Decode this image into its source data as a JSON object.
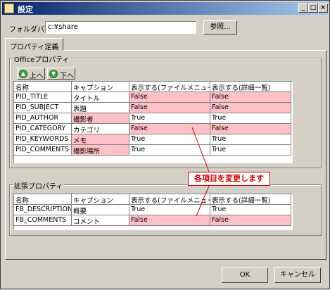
{
  "window": {
    "title": "設定"
  },
  "titlebar_buttons": [
    "_",
    "□",
    "×"
  ],
  "folder": {
    "label": "フォルダパス",
    "value": "c:¥share",
    "browse_label": "参照..."
  },
  "tab": {
    "label": "プロパティ定義"
  },
  "office": {
    "group_title": "Officeプロパティ",
    "up_label": "上へ",
    "down_label": "下へ",
    "columns": [
      "名称",
      "キャプション",
      "表示する(ファイルメニュー)",
      "表示する(詳細一覧)"
    ],
    "rows": [
      {
        "name": "PID_TITLE",
        "caption": "タイトル",
        "file_menu": "False",
        "detail": "False"
      },
      {
        "name": "PID_SUBJECT",
        "caption": "表題",
        "file_menu": "False",
        "detail": "False"
      },
      {
        "name": "PID_AUTHOR",
        "caption": "撮影者",
        "file_menu": "True",
        "detail": "True"
      },
      {
        "name": "PID_CATEGORY",
        "caption": "カテゴリ",
        "file_menu": "False",
        "detail": "False"
      },
      {
        "name": "PID_KEYWORDS",
        "caption": "メモ",
        "file_menu": "True",
        "detail": "True"
      },
      {
        "name": "PID_COMMENTS",
        "caption": "撮影場所",
        "file_menu": "True",
        "detail": "True"
      }
    ]
  },
  "extended": {
    "group_title": "拡張プロパティ",
    "columns": [
      "名称",
      "キャプション",
      "表示する(ファイルメニュー)",
      "表示する(詳細一覧)"
    ],
    "rows": [
      {
        "name": "FB_DESCRIPTION",
        "caption": "概要",
        "file_menu": "True",
        "detail": "True"
      },
      {
        "name": "FB_COMMENTS",
        "caption": "コメント",
        "file_menu": "False",
        "detail": "False"
      }
    ]
  },
  "annotation": {
    "text": "各項目を変更します",
    "color": "#cc0000"
  },
  "highlight_color": "#ffc0c8",
  "footer": {
    "ok_label": "OK",
    "cancel_label": "キャンセル"
  }
}
